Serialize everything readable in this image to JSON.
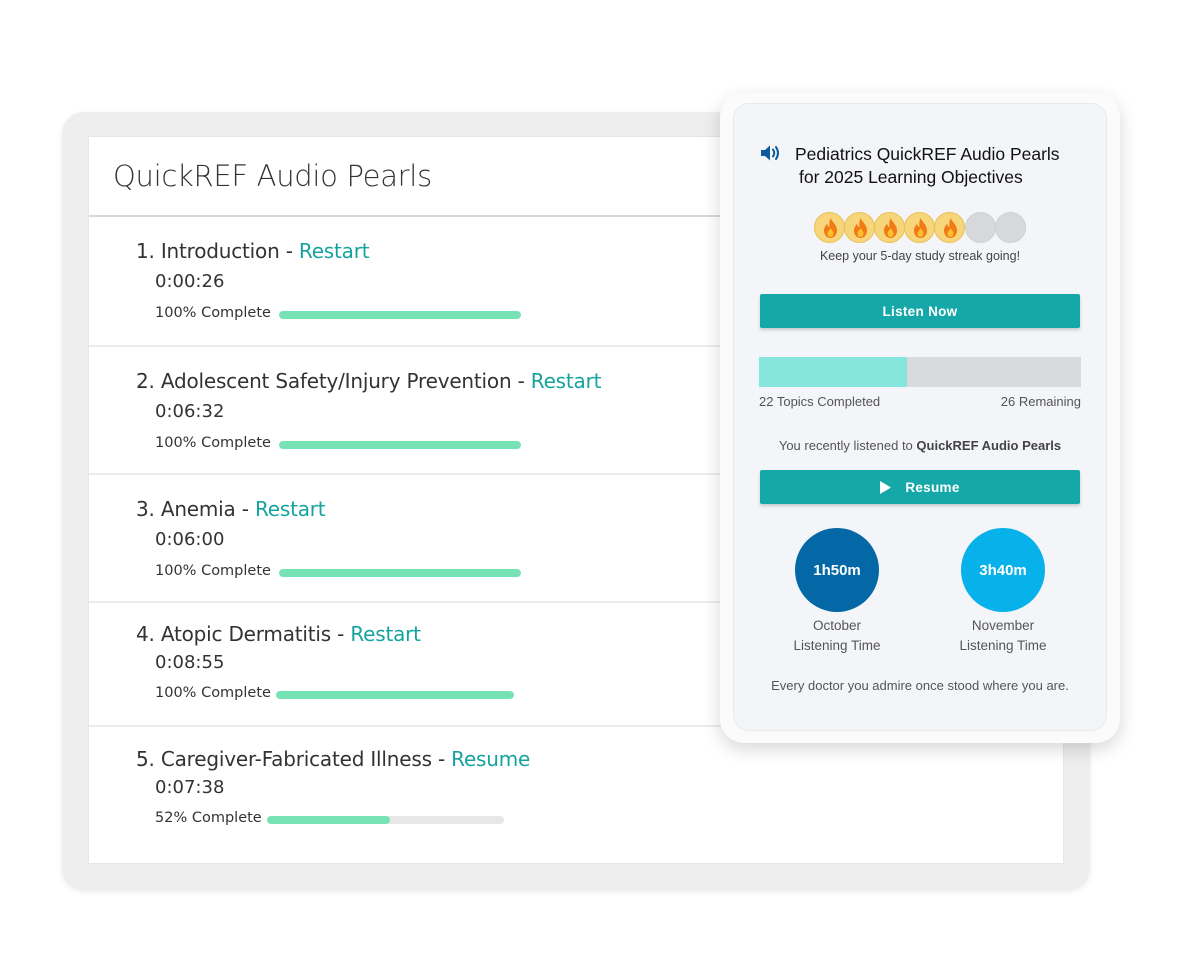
{
  "list": {
    "title": "QuickREF Audio Pearls",
    "topics": [
      {
        "name": "1. Introduction",
        "sep": " - ",
        "action": "Restart",
        "time": "0:00:26",
        "percent_label": "100% Complete",
        "progress": 1.0
      },
      {
        "name": "2. Adolescent Safety/Injury Prevention",
        "sep": " - ",
        "action": "Restart",
        "time": "0:06:32",
        "percent_label": "100% Complete",
        "progress": 1.0
      },
      {
        "name": "3. Anemia",
        "sep": " - ",
        "action": "Restart",
        "time": "0:06:00",
        "percent_label": "100% Complete",
        "progress": 1.0
      },
      {
        "name": "4. Atopic Dermatitis",
        "sep": " - ",
        "action": "Restart",
        "time": "0:08:55",
        "percent_label": "100% Complete",
        "progress": 1.0
      },
      {
        "name": "5. Caregiver-Fabricated Illness",
        "sep": " - ",
        "action": "Resume",
        "time": "0:07:38",
        "percent_label": "52% Complete",
        "progress": 0.52
      }
    ]
  },
  "widget": {
    "icon": "speaker-icon",
    "title_line1": "Pediatrics QuickREF Audio Pearls",
    "title_line2": "for 2025 Learning Objectives",
    "streak": {
      "days_done": 5,
      "days_total": 7,
      "icon": "flame-icon",
      "text": "Keep your 5-day study streak going!"
    },
    "listen_label": "Listen Now",
    "topics_progress": 0.4583,
    "topics_completed": "22 Topics Completed",
    "topics_remaining": "26 Remaining",
    "recent_prefix": "You recently listened to ",
    "recent_title": "QuickREF Audio Pearls",
    "resume_label": "Resume",
    "resume_icon": "play-icon",
    "stats": [
      {
        "value": "1h50m",
        "month": "October",
        "caption": "Listening Time",
        "color": "#0467a6"
      },
      {
        "value": "3h40m",
        "month": "November",
        "caption": "Listening Time",
        "color": "#07b1ea"
      }
    ],
    "quote": "Every doctor you admire once stood where you are."
  },
  "colors": {
    "accent": "#16a8a8",
    "link": "#16a3a0",
    "progress_fill": "#76e3b4",
    "topics_fill": "#86e6dd"
  }
}
